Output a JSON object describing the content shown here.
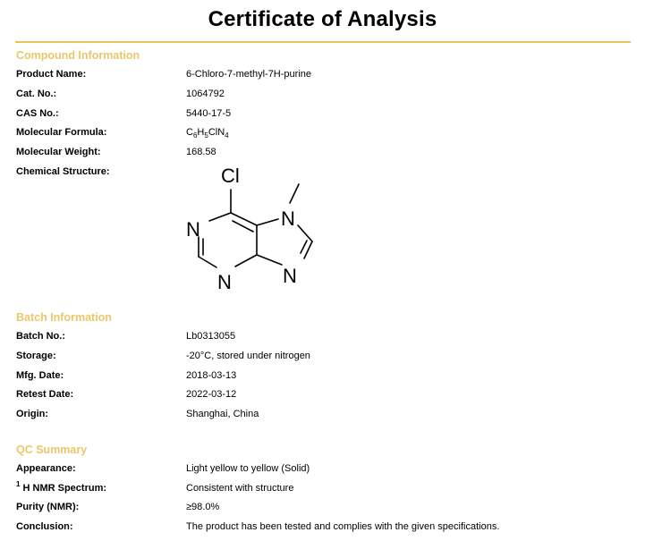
{
  "title": "Certificate of Analysis",
  "compound": {
    "heading": "Compound Information",
    "product_name_label": "Product Name:",
    "product_name": "6-Chloro-7-methyl-7H-purine",
    "cat_no_label": "Cat. No.:",
    "cat_no": "1064792",
    "cas_no_label": "CAS No.:",
    "cas_no": "5440-17-5",
    "formula_label": "Molecular Formula:",
    "formula": {
      "c": "C",
      "c_count": "6",
      "h": "H",
      "h_count": "5",
      "cln": "ClN",
      "n_count": "4"
    },
    "weight_label": "Molecular Weight:",
    "weight": "168.58",
    "structure_label": "Chemical Structure:",
    "structure_atoms": {
      "cl": "Cl",
      "n1": "N",
      "n3": "N",
      "n7": "N",
      "n9": "N"
    }
  },
  "batch": {
    "heading": "Batch Information",
    "batch_no_label": "Batch No.:",
    "batch_no": "Lb0313055",
    "storage_label": "Storage:",
    "storage": "-20°C, stored under nitrogen",
    "mfg_label": "Mfg. Date:",
    "mfg_date": "2018-03-13",
    "retest_label": "Retest Date:",
    "retest_date": "2022-03-12",
    "origin_label": "Origin:",
    "origin": "Shanghai, China"
  },
  "qc": {
    "heading": "QC Summary",
    "appearance_label": "Appearance:",
    "appearance": "Light yellow to yellow (Solid)",
    "nmr_sup": "1",
    "nmr_label": " H NMR Spectrum:",
    "nmr": "Consistent with structure",
    "purity_label": "Purity (NMR):",
    "purity": "≥98.0%",
    "conclusion_label": "Conclusion:",
    "conclusion": "The product has been tested and complies with the given specifications."
  },
  "colors": {
    "accent": "#ecc66a",
    "rule": "#e8c45c",
    "text": "#000000"
  }
}
